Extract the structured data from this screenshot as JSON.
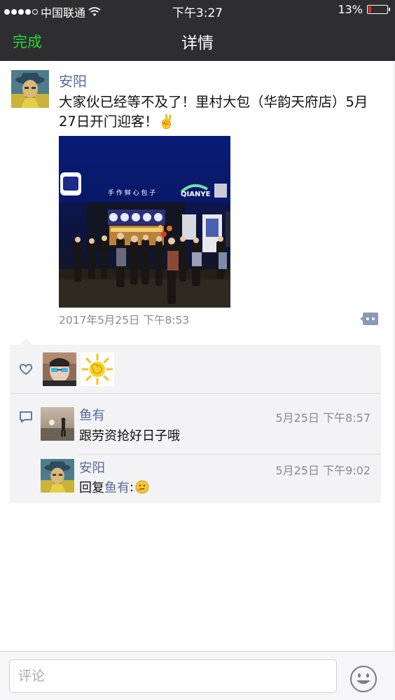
{
  "status_bar": {
    "carrier": "中国联通",
    "time": "下午3:27",
    "battery": "13%"
  },
  "nav": {
    "done_label": "完成",
    "title": "详情"
  },
  "post": {
    "author": "安阳",
    "text": "大家伙已经等不及了！里村大包（华韵天府店）5月27日开门迎客！✌️",
    "timestamp": "2017年5月25日 下午8:53",
    "photo_sign": "QIANYE"
  },
  "likes": {
    "users": [
      "user-avatar-sunglasses",
      "user-avatar-sun"
    ]
  },
  "comments": [
    {
      "author": "鱼有",
      "time": "5月25日 下午8:57",
      "text": "跟劳资抢好日子哦"
    },
    {
      "author": "安阳",
      "time": "5月25日 下午9:02",
      "reply_prefix": "回复",
      "reply_target": "鱼有",
      "reply_suffix": ":"
    }
  ],
  "bottom_bar": {
    "comment_placeholder": "评论"
  },
  "colors": {
    "bar_bg": "#2e2e30",
    "done_green": "#2bd13a",
    "name_blue": "#576b95",
    "panel_bg": "#f3f3f5"
  }
}
